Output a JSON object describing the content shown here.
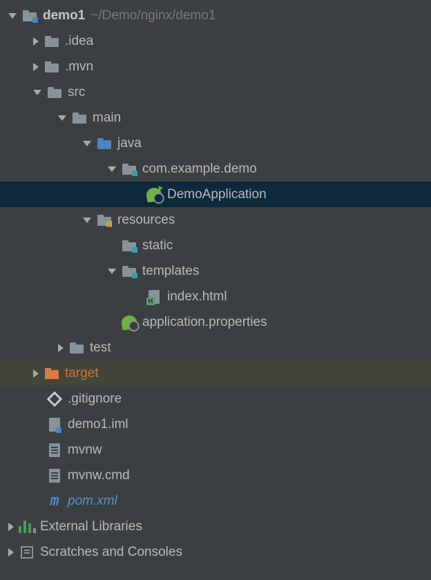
{
  "tree": [
    {
      "indent": 12,
      "arrow": "down",
      "icon": "module-folder",
      "label": "demo1",
      "bold": true,
      "hint": "~/Demo/nginx/demo1"
    },
    {
      "indent": 48,
      "arrow": "right",
      "icon": "folder",
      "label": ".idea"
    },
    {
      "indent": 48,
      "arrow": "right",
      "icon": "folder",
      "label": ".mvn"
    },
    {
      "indent": 48,
      "arrow": "down",
      "icon": "folder",
      "label": "src"
    },
    {
      "indent": 84,
      "arrow": "down",
      "icon": "folder",
      "label": "main"
    },
    {
      "indent": 120,
      "arrow": "down",
      "icon": "source-folder",
      "label": "java"
    },
    {
      "indent": 156,
      "arrow": "down",
      "icon": "package",
      "label": "com.example.demo"
    },
    {
      "indent": 192,
      "arrow": "none",
      "icon": "spring-run",
      "label": "DemoApplication",
      "selected": true
    },
    {
      "indent": 120,
      "arrow": "down",
      "icon": "resources-folder",
      "label": "resources"
    },
    {
      "indent": 156,
      "arrow": "none",
      "icon": "package",
      "label": "static"
    },
    {
      "indent": 156,
      "arrow": "down",
      "icon": "package",
      "label": "templates"
    },
    {
      "indent": 192,
      "arrow": "none",
      "icon": "html-file",
      "label": "index.html"
    },
    {
      "indent": 156,
      "arrow": "none",
      "icon": "spring-props",
      "label": "application.properties"
    },
    {
      "indent": 84,
      "arrow": "right",
      "icon": "folder",
      "label": "test"
    },
    {
      "indent": 48,
      "arrow": "right",
      "icon": "target-folder",
      "label": "target",
      "highlighted": true,
      "labelClass": "orange"
    },
    {
      "indent": 48,
      "arrow": "none",
      "icon": "gitignore",
      "label": ".gitignore"
    },
    {
      "indent": 48,
      "arrow": "none",
      "icon": "iml-file",
      "label": "demo1.iml"
    },
    {
      "indent": 48,
      "arrow": "none",
      "icon": "text-file",
      "label": "mvnw"
    },
    {
      "indent": 48,
      "arrow": "none",
      "icon": "text-file",
      "label": "mvnw.cmd"
    },
    {
      "indent": 48,
      "arrow": "none",
      "icon": "pom-file",
      "label": "pom.xml",
      "labelClass": "blue-italic"
    },
    {
      "indent": 12,
      "arrow": "right",
      "icon": "libraries",
      "label": "External Libraries"
    },
    {
      "indent": 12,
      "arrow": "right",
      "icon": "scratches",
      "label": "Scratches and Consoles"
    }
  ]
}
